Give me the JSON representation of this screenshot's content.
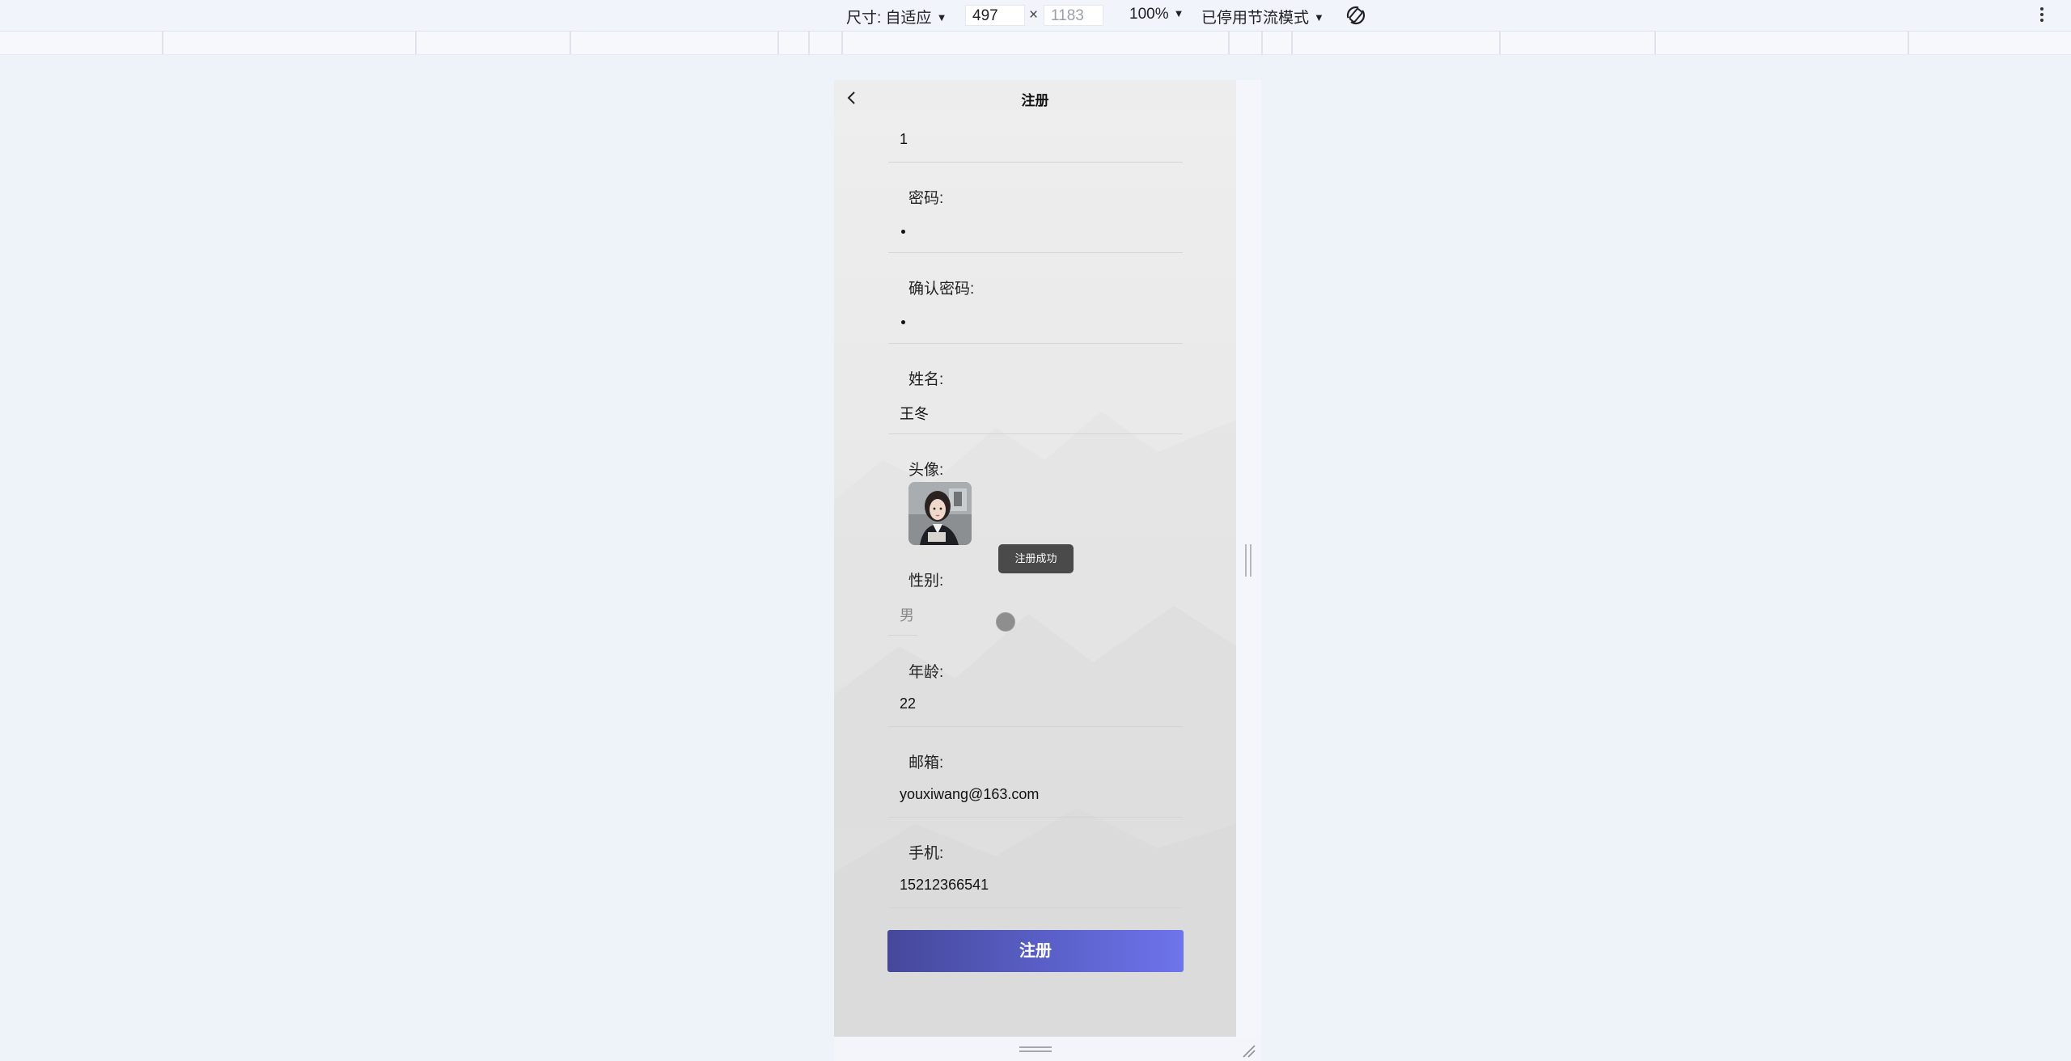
{
  "devtools": {
    "dimensions_label": "尺寸: 自适应",
    "width": "497",
    "height": "1183",
    "times": "×",
    "zoom": "100%",
    "throttle": "已停用节流模式",
    "rotate_icon": "rotate-icon",
    "more_icon": "more-vert-icon"
  },
  "page": {
    "title": "注册",
    "back_icon": "chevron-left-icon",
    "fields": {
      "account": {
        "value": "1"
      },
      "password": {
        "label": "密码:"
      },
      "confirm_password": {
        "label": "确认密码:"
      },
      "name": {
        "label": "姓名:",
        "value": "王冬"
      },
      "avatar": {
        "label": "头像:"
      },
      "gender": {
        "label": "性别:",
        "value": "男"
      },
      "age": {
        "label": "年龄:",
        "value": "22"
      },
      "email": {
        "label": "邮箱:",
        "value": "youxiwang@163.com"
      },
      "phone": {
        "label": "手机:",
        "value": "15212366541"
      }
    },
    "toast": "注册成功",
    "submit_label": "注册",
    "submit_gradient": [
      "#45489a",
      "#6e74ea"
    ]
  }
}
